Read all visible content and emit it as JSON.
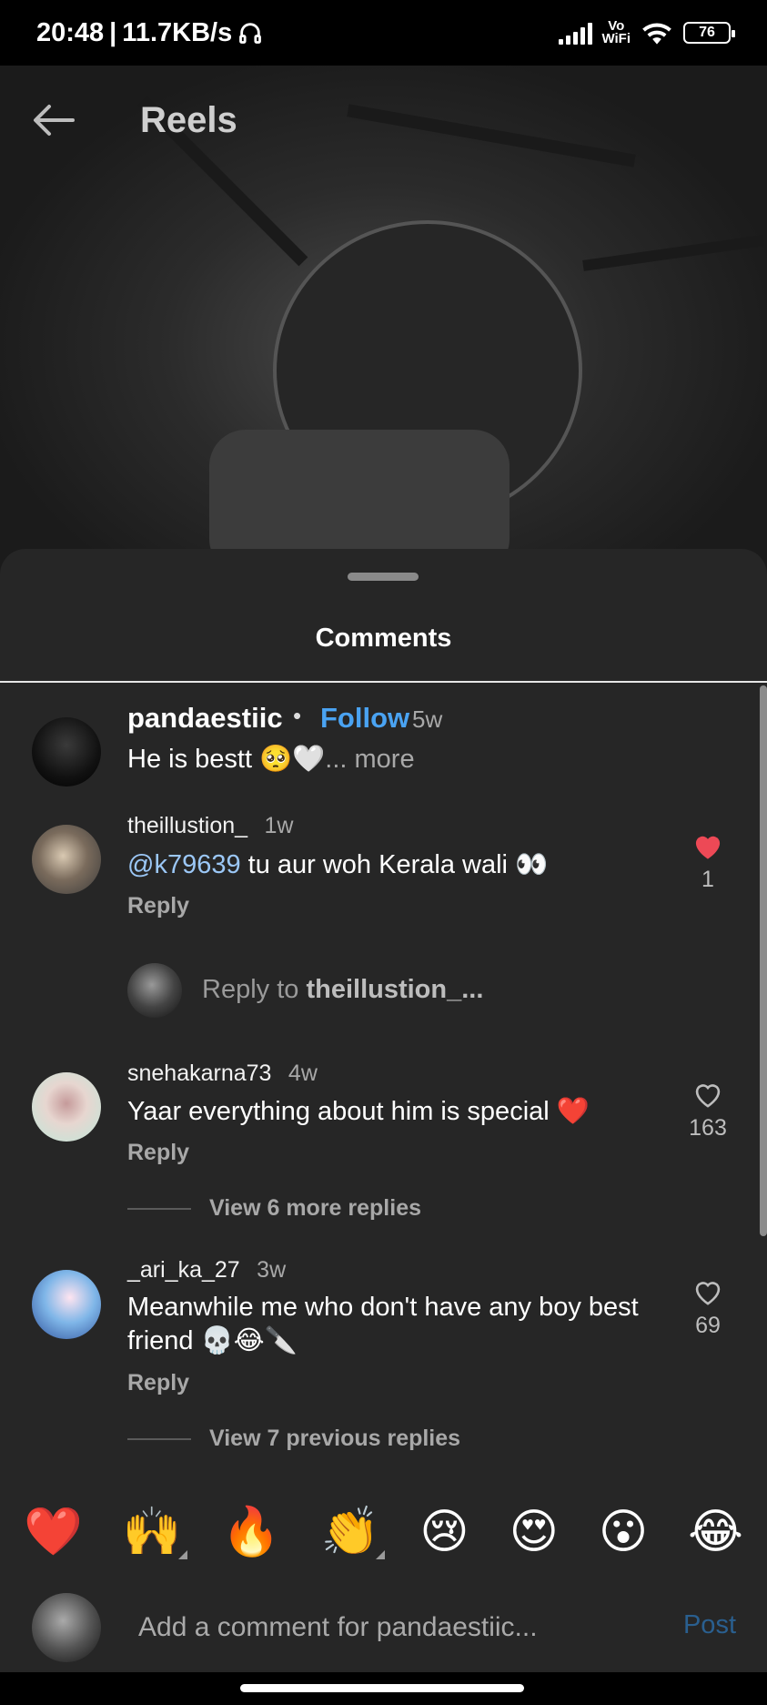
{
  "status_bar": {
    "time": "20:48",
    "network_speed": "11.7KB/s",
    "vowifi_top": "Vo",
    "vowifi_bottom": "WiFi",
    "battery": "76"
  },
  "header": {
    "title": "Reels"
  },
  "sheet": {
    "title": "Comments"
  },
  "post": {
    "username": "pandaestiic",
    "separator": "•",
    "follow_label": "Follow",
    "time": "5w",
    "caption": "He is bestt 🥺🤍",
    "more_label": "... more"
  },
  "comments": [
    {
      "username": "theillustion_",
      "time": "1w",
      "mention": "@k79639",
      "text": " tu aur woh Kerala wali 👀",
      "reply_label": "Reply",
      "likes": "1",
      "liked": true
    },
    {
      "username": "snehakarna73",
      "time": "4w",
      "text": "Yaar everything about him is special ❤️",
      "reply_label": "Reply",
      "likes": "163",
      "liked": false,
      "view_more": "View 6 more replies"
    },
    {
      "username": "_ari_ka_27",
      "time": "3w",
      "text_line1": "Meanwhile me who don't have any boy best",
      "text_line2": "friend 💀😂🔪",
      "reply_label": "Reply",
      "likes": "69",
      "liked": false,
      "view_more": "View 7 previous replies"
    }
  ],
  "reply_prompt": {
    "prefix": "Reply to ",
    "target": "theillustion_..."
  },
  "reactions": [
    "❤️",
    "🙌",
    "🔥",
    "👏",
    "😢",
    "😍",
    "😮",
    "😂"
  ],
  "composer": {
    "placeholder": "Add a comment for pandaestiic...",
    "post_label": "Post"
  },
  "colors": {
    "accent": "#4aa3f2",
    "like_active": "#ed4956",
    "sheet_bg": "#262626"
  }
}
